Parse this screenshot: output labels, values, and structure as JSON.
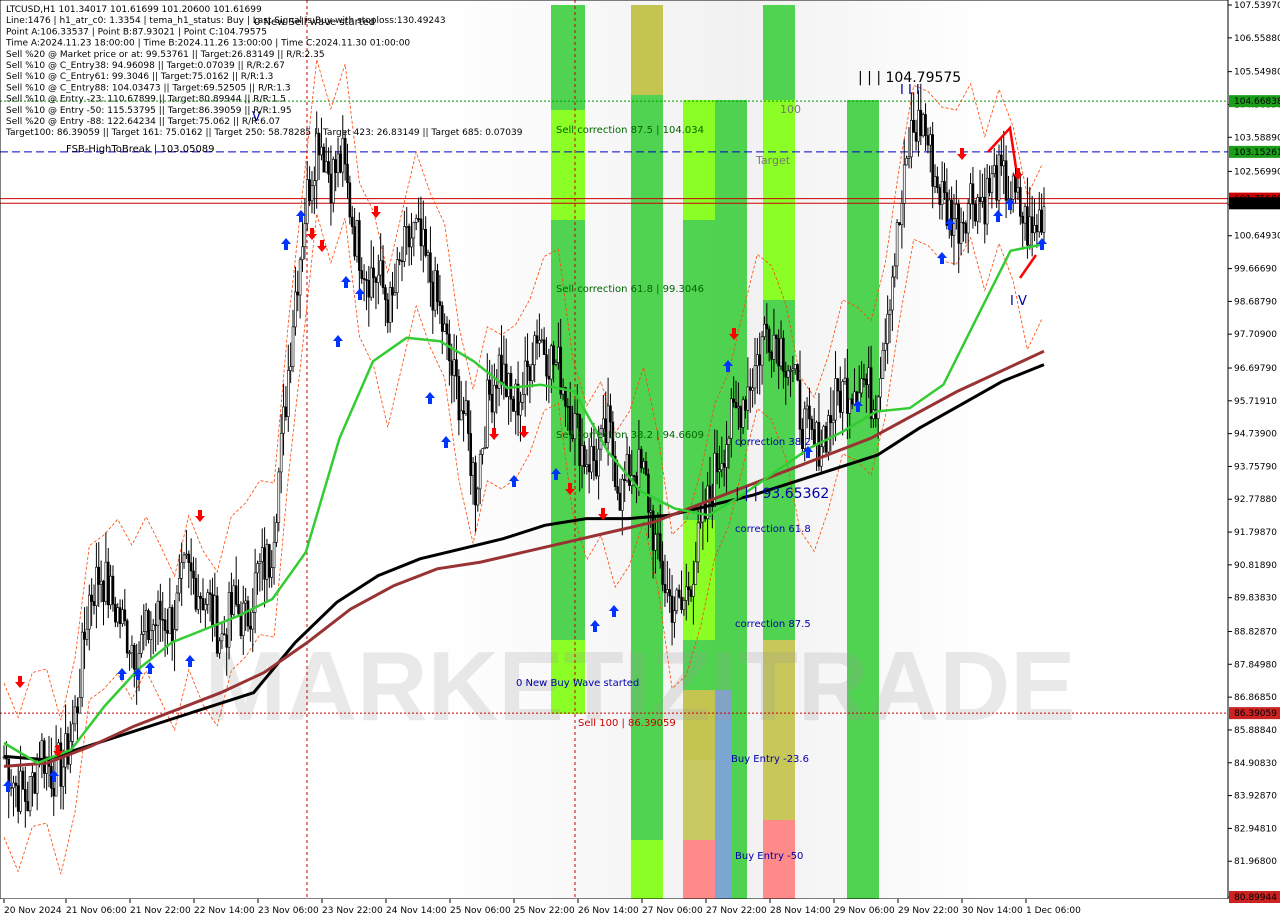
{
  "colors": {
    "background": "#ffffff",
    "green_zone": "#33cc33",
    "lime_zone": "#77ff00",
    "olive_zone": "#bbbb33",
    "salmon_zone": "#ff7777",
    "steel_zone": "#6699cc",
    "ma_green": "#33cc33",
    "ma_brown": "#993333",
    "ma_black": "#000000",
    "dotted_orange": "#ff4400",
    "level_green": "#009900",
    "level_blue": "#0000cc",
    "level_red": "#cc0000",
    "label_blue": "#0000aa",
    "label_red": "#cc0000",
    "label_green": "#006600",
    "arrow_up": "#0033ff",
    "arrow_down": "#ff0000"
  },
  "header_info": [
    "LTCUSD,H1  101.34017 101.61699 101.20600 101.61699",
    "Line:1476 | h1_atr_c0: 1.3354 | tema_h1_status: Buy | Last Signal is:Buy with stoploss:130.49243",
    "Point A:106.33537 | Point B:87.93021 | Point C:104.79575",
    "Time A:2024.11.23 18:00:00 | Time B:2024.11.26 13:00:00 | Time C:2024.11.30 01:00:00",
    "Sell %20 @ Market price or at: 99.53761 || Target:26.83149 || R/R:2.35",
    "Sell %10 @ C_Entry38: 94.96098 || Target:0.07039 || R/R:2.67",
    "Sell %10 @ C_Entry61: 99.3046 || Target:75.0162 || R/R:1.3",
    "Sell %10 @ C_Entry88: 104.03473 || Target:69.52505 || R/R:1.3",
    "Sell %10 @ Entry -23: 110.67899 || Target:80.89944 || R/R:1.5",
    "Sell %10 @ Entry -50: 115.53795 || Target:86.39059 || R/R:1.95",
    "Sell %20 @ Entry -88: 122.64234 || Target:75.062 || R/R:6.07",
    "Target100: 86.39059 || Target 161: 75.0162 || Target 250: 58.78285 || Target 423: 26.83149 || Target 685: 0.07039"
  ],
  "chart_labels": {
    "new_sell_wave": "0 New Sell wave started",
    "new_buy_wave": "0 New Buy Wave started",
    "fsb_high": "FSB-HighToBreak | 103.05089",
    "sell_corr_875": "Sell correction 87.5 | 104.034",
    "sell_corr_618": "Sell correction 61.8 | 99.3046",
    "sell_corr_382": "Sell correction 38.2 | 94.6609",
    "sell_100": "Sell 100 | 86.39059",
    "correction_382": "correction 38.2",
    "correction_618": "correction 61.8",
    "correction_875": "correction 87.5",
    "buy_entry_236": "Buy Entry -23.6",
    "buy_entry_50": "Buy Entry -50",
    "point_c": "| | | 104.79575",
    "point_b": "| | | 93.65362",
    "label_100": "100",
    "label_target": "Target",
    "label_iv": "I V",
    "label_iii": "I I I",
    "label_v": "V",
    "watermark": "MARKETIZITRADE"
  },
  "price_badges": {
    "level_green": "104.66838",
    "level_blue": "103.15261",
    "level_red_hidden": "101.75690",
    "current": "101.61699",
    "sell100": "86.39059",
    "bottom": "80.89944"
  },
  "chart_data": {
    "type": "candlestick",
    "symbol": "LTCUSD",
    "timeframe": "H1",
    "ylim": [
      80.89944,
      107.5397
    ],
    "y_ticks": [
      "107.53970",
      "106.55880",
      "105.54980",
      "104.56890",
      "103.58890",
      "102.56990",
      "101.57900",
      "100.64930",
      "99.66690",
      "98.68790",
      "97.70900",
      "96.69790",
      "95.71910",
      "94.73900",
      "93.75790",
      "92.77880",
      "91.79870",
      "90.81890",
      "89.83830",
      "88.82870",
      "87.84980",
      "86.86850",
      "85.88840",
      "84.90830",
      "83.92870",
      "82.94810",
      "81.96800",
      "80.89944"
    ],
    "x_ticks": [
      "20 Nov 2024",
      "21 Nov 06:00",
      "21 Nov 22:00",
      "22 Nov 14:00",
      "23 Nov 06:00",
      "23 Nov 22:00",
      "24 Nov 14:00",
      "25 Nov 06:00",
      "25 Nov 22:00",
      "26 Nov 14:00",
      "27 Nov 06:00",
      "27 Nov 22:00",
      "28 Nov 14:00",
      "29 Nov 06:00",
      "29 Nov 22:00",
      "30 Nov 14:00",
      "1 Dec 06:00"
    ],
    "levels": {
      "green_dotted": 104.66838,
      "blue_dashed": 103.15261,
      "red_solid_1": 101.7569,
      "red_solid_2": 101.61699,
      "red_dotted": 86.39059
    },
    "close_path": [
      85.1,
      84.2,
      83.8,
      85.4,
      84.6,
      84.9,
      86.5,
      89.8,
      90.6,
      89.7,
      88.9,
      88.2,
      88.9,
      89.3,
      89.1,
      90.6,
      90.2,
      89.6,
      88.6,
      89.6,
      89.1,
      90.6,
      91.0,
      94.5,
      98.7,
      101.7,
      103.8,
      102.4,
      102.9,
      100.7,
      99.6,
      99.4,
      98.4,
      100.1,
      100.8,
      99.7,
      98.4,
      96.6,
      95.4,
      93.1,
      95.7,
      96.9,
      95.5,
      96.1,
      97.9,
      97.1,
      96.6,
      95.2,
      94.1,
      93.9,
      94.9,
      92.9,
      93.8,
      93.4,
      91.1,
      89.8,
      89.4,
      90.8,
      92.3,
      93.9,
      94.9,
      95.7,
      96.6,
      97.9,
      97.6,
      96.8,
      95.1,
      94.3,
      94.9,
      95.9,
      96.2,
      96.4,
      95.6,
      98.4,
      100.9,
      103.7,
      104.1,
      102.4,
      101.4,
      101.1,
      101.9,
      101.7,
      102.4,
      102.1,
      101.4,
      100.6,
      101.6
    ],
    "ma_green": [
      85.5,
      84.9,
      85.3,
      86.6,
      87.7,
      88.5,
      88.9,
      89.3,
      89.8,
      91.2,
      94.6,
      96.9,
      97.6,
      97.5,
      96.9,
      96.1,
      96.2,
      96.0,
      94.2,
      93.0,
      92.5,
      92.3,
      92.9,
      93.6,
      94.3,
      94.8,
      95.4,
      95.5,
      96.2,
      98.2,
      100.2,
      100.4
    ],
    "ma_brown": [
      84.8,
      84.9,
      85.4,
      86.0,
      86.5,
      87.0,
      87.6,
      88.5,
      89.5,
      90.2,
      90.7,
      90.9,
      91.2,
      91.5,
      91.8,
      92.1,
      92.6,
      93.1,
      93.6,
      94.1,
      94.6,
      95.3,
      96.0,
      96.6,
      97.2
    ],
    "ma_black": [
      85.1,
      85.0,
      85.4,
      85.8,
      86.2,
      86.6,
      87.0,
      88.5,
      89.7,
      90.5,
      91.0,
      91.3,
      91.6,
      92.0,
      92.2,
      92.2,
      92.3,
      92.6,
      92.9,
      93.3,
      93.7,
      94.1,
      94.9,
      95.6,
      96.3,
      96.8
    ]
  }
}
